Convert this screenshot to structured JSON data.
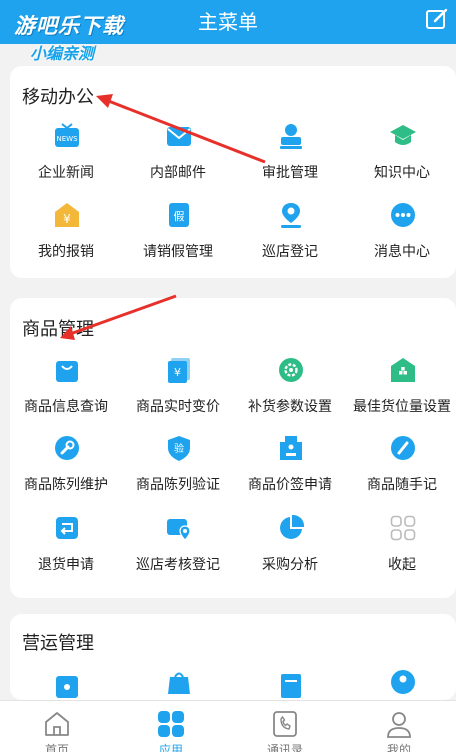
{
  "header": {
    "title": "主菜单"
  },
  "watermark": {
    "line1": "游吧乐下载",
    "line2": "小编亲测"
  },
  "colors": {
    "primary": "#1fa3ee",
    "annotation": "#e8302a"
  },
  "sections": [
    {
      "title": "移动办公",
      "items": [
        {
          "label": "企业新闻",
          "icon": "news-icon"
        },
        {
          "label": "内部邮件",
          "icon": "mail-icon"
        },
        {
          "label": "审批管理",
          "icon": "approval-icon"
        },
        {
          "label": "知识中心",
          "icon": "graduation-cap-icon"
        },
        {
          "label": "我的报销",
          "icon": "reimbursement-icon"
        },
        {
          "label": "请销假管理",
          "icon": "leave-icon"
        },
        {
          "label": "巡店登记",
          "icon": "location-pin-icon"
        },
        {
          "label": "消息中心",
          "icon": "chat-bubble-icon"
        }
      ]
    },
    {
      "title": "商品管理",
      "items": [
        {
          "label": "商品信息查询",
          "icon": "shopping-bag-icon"
        },
        {
          "label": "商品实时变价",
          "icon": "price-change-icon"
        },
        {
          "label": "补货参数设置",
          "icon": "settings-gear-icon"
        },
        {
          "label": "最佳货位量设置",
          "icon": "warehouse-icon"
        },
        {
          "label": "商品陈列维护",
          "icon": "wrench-icon"
        },
        {
          "label": "商品陈列验证",
          "icon": "verify-shield-icon"
        },
        {
          "label": "商品价签申请",
          "icon": "price-tag-icon"
        },
        {
          "label": "商品随手记",
          "icon": "pen-icon"
        },
        {
          "label": "退货申请",
          "icon": "return-icon"
        },
        {
          "label": "巡店考核登记",
          "icon": "inspection-icon"
        },
        {
          "label": "采购分析",
          "icon": "pie-chart-icon"
        },
        {
          "label": "收起",
          "icon": "grid-icon"
        }
      ]
    },
    {
      "title": "营运管理",
      "items": []
    }
  ],
  "tabs": [
    {
      "label": "首页",
      "icon": "home-icon",
      "active": false
    },
    {
      "label": "应用",
      "icon": "apps-icon",
      "active": true
    },
    {
      "label": "通讯录",
      "icon": "phone-book-icon",
      "active": false
    },
    {
      "label": "我的",
      "icon": "user-icon",
      "active": false
    }
  ]
}
